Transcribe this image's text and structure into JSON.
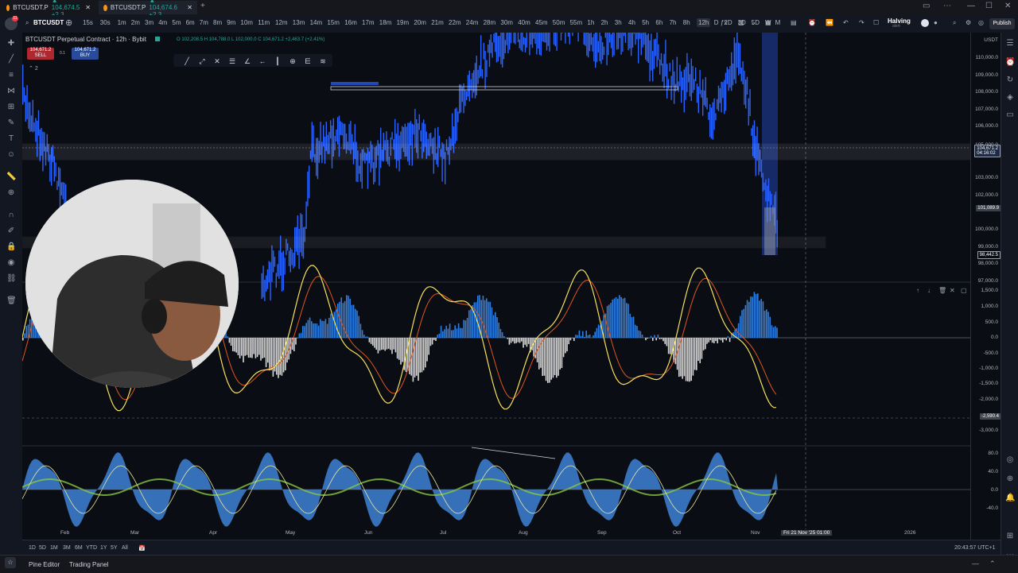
{
  "tabs": [
    {
      "label": "BTCUSDT.P",
      "change": "▲ 104,674.5 +2.3…",
      "active": false
    },
    {
      "label": "BTCUSDT.P",
      "change": "▲ 104,674.6 +2.3…",
      "active": true
    }
  ],
  "toolbar": {
    "symbol": "BTCUSDT",
    "timeframes": [
      "15s",
      "30s",
      "1m",
      "2m",
      "3m",
      "4m",
      "5m",
      "6m",
      "7m",
      "8m",
      "9m",
      "10m",
      "11m",
      "12m",
      "13m",
      "14m",
      "15m",
      "16m",
      "17m",
      "18m",
      "19m",
      "20m",
      "21m",
      "22m",
      "24m",
      "28m",
      "30m",
      "40m",
      "45m",
      "50m",
      "55m",
      "1h",
      "2h",
      "3h",
      "4h",
      "5h",
      "6h",
      "7h",
      "8h",
      "12h",
      "D",
      "2D",
      "3D",
      "5D",
      "W",
      "M"
    ],
    "selected_timeframe": "12h",
    "halving_label": "Halving",
    "halving_sub": "alert",
    "publish_label": "Publish"
  },
  "legend": {
    "title": "BTCUSDT Perpetual Contract · 12h · Bybit",
    "ohlc": "O 102,208.5  H 104,788.0  L 102,000.0  C 104,671.2  +2,463.7 (+2.41%)",
    "sell_price": "104,671.2",
    "sell_label": "SELL",
    "spread": "0.1",
    "buy_price": "104,671.2",
    "buy_label": "BUY",
    "indicator_count": "2"
  },
  "price_axis": {
    "currency": "USDT",
    "labels": [
      "110,000.0",
      "109,000.0",
      "108,000.0",
      "107,000.0",
      "106,000.0",
      "105,000.0",
      "103,000.0",
      "102,000.0",
      "100,000.0",
      "99,000.0",
      "98,000.0",
      "97,000.0"
    ],
    "last_price_tag": "104,671.2",
    "last_price_timer": "04:16:02",
    "tag_a": "101,089.9",
    "tag_b": "98,442.5"
  },
  "osc1_axis": {
    "labels": [
      "1,500.0",
      "1,000.0",
      "500.0",
      "0.0",
      "-500.0",
      "-1,000.0",
      "-1,500.0",
      "-2,000.0",
      "-3,000.0"
    ],
    "cursor_tag": "-2,590.4"
  },
  "osc2_axis": {
    "labels": [
      "80.0",
      "40.0",
      "0.0",
      "-40.0"
    ]
  },
  "time_axis": {
    "labels": [
      "Feb",
      "Mar",
      "Apr",
      "May",
      "Jun",
      "Jul",
      "Aug",
      "Sep",
      "Oct",
      "Nov",
      "2026"
    ],
    "cursor_label": "Fri 21 Nov '25   01:00"
  },
  "range_buttons": [
    "1D",
    "5D",
    "1M",
    "3M",
    "6M",
    "YTD",
    "1Y",
    "5Y",
    "All"
  ],
  "clock": "20:43:57 UTC+1",
  "footer": {
    "pine": "Pine Editor",
    "trading": "Trading Panel"
  },
  "colors": {
    "bg": "#0b0d14",
    "candle": "#2962ff",
    "hist_pos": "#2f7fe0",
    "hist_neg": "#d8d8d8",
    "fast": "#f5e15c",
    "slow": "#e0561f",
    "wave": "#3d83d6",
    "green": "#86c541"
  }
}
